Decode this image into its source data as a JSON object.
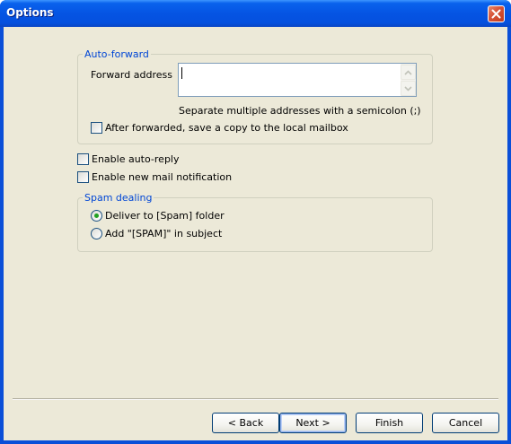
{
  "window": {
    "title": "Options",
    "close_icon": "close-icon"
  },
  "auto_forward": {
    "legend": "Auto-forward",
    "forward_address_label": "Forward address",
    "forward_address_value": "",
    "hint": "Separate multiple addresses with a semicolon (;)",
    "save_copy_label": "After forwarded, save a copy to the local mailbox",
    "save_copy_checked": false
  },
  "options": {
    "auto_reply_label": "Enable auto-reply",
    "auto_reply_checked": false,
    "notification_label": "Enable new mail notification",
    "notification_checked": false
  },
  "spam": {
    "legend": "Spam dealing",
    "deliver_label": "Deliver to [Spam] folder",
    "deliver_selected": true,
    "add_label": "Add \"[SPAM]\" in subject",
    "add_selected": false
  },
  "buttons": {
    "back": "< Back",
    "next": "Next >",
    "finish": "Finish",
    "cancel": "Cancel"
  },
  "colors": {
    "titlebar": "#0554e3",
    "client": "#ece9d8",
    "group_legend": "#0046d5",
    "close_button": "#d8563b",
    "radio_dot": "#21a121"
  }
}
